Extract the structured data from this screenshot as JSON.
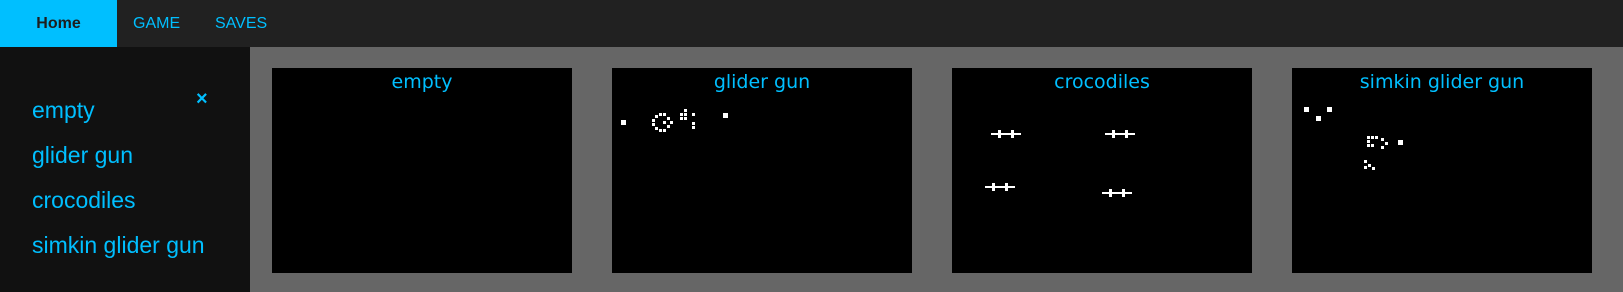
{
  "nav": {
    "home_label": "Home",
    "game_label": "GAME",
    "saves_label": "SAVES"
  },
  "sidebar": {
    "close_glyph": "×",
    "items": [
      {
        "label": "empty"
      },
      {
        "label": "glider gun"
      },
      {
        "label": "crocodiles"
      },
      {
        "label": "simkin glider gun"
      }
    ]
  },
  "panels": [
    {
      "title": "empty"
    },
    {
      "title": "glider gun"
    },
    {
      "title": "crocodiles"
    },
    {
      "title": "simkin glider gun"
    }
  ],
  "colors": {
    "accent": "#00bfff",
    "topbar": "#212121",
    "sidebar": "#111111",
    "background": "#666666",
    "canvas": "#000000",
    "cell": "#ffffff"
  }
}
